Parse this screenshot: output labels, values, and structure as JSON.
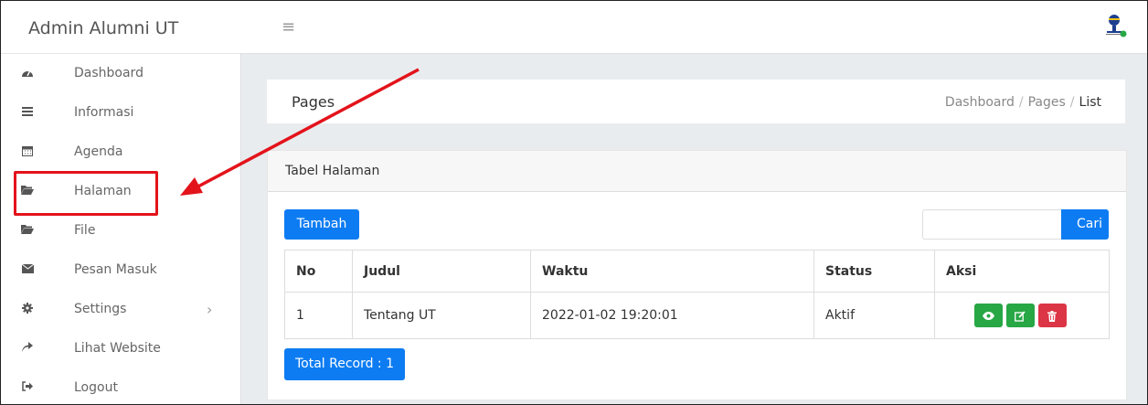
{
  "sidebar": {
    "brand": "Admin Alumni UT",
    "items": [
      {
        "label": "Dashboard",
        "icon": "dashboard-icon"
      },
      {
        "label": "Informasi",
        "icon": "list-icon"
      },
      {
        "label": "Agenda",
        "icon": "calendar-icon"
      },
      {
        "label": "Halaman",
        "icon": "folder-open-icon"
      },
      {
        "label": "File",
        "icon": "folder-open-icon"
      },
      {
        "label": "Pesan Masuk",
        "icon": "envelope-icon"
      },
      {
        "label": "Settings",
        "icon": "cog-icon",
        "chevron": "›"
      },
      {
        "label": "Lihat Website",
        "icon": "share-icon"
      },
      {
        "label": "Logout",
        "icon": "sign-out-icon"
      }
    ]
  },
  "header": {
    "menu_icon": "≡"
  },
  "page": {
    "title": "Pages",
    "breadcrumb": [
      "Dashboard",
      "Pages",
      "List"
    ],
    "breadcrumb_sep": "/"
  },
  "card": {
    "title": "Tabel Halaman",
    "add_button": "Tambah",
    "search_placeholder": "",
    "search_button": "Cari",
    "columns": [
      "No",
      "Judul",
      "Waktu",
      "Status",
      "Aksi"
    ],
    "rows": [
      {
        "no": "1",
        "judul": "Tentang UT",
        "waktu": "2022-01-02 19:20:01",
        "status": "Aktif"
      }
    ],
    "total_label": "Total Record : 1"
  },
  "colors": {
    "primary": "#0d7cf2",
    "success": "#28a745",
    "danger": "#dc3545",
    "annotation": "#e3131b"
  }
}
